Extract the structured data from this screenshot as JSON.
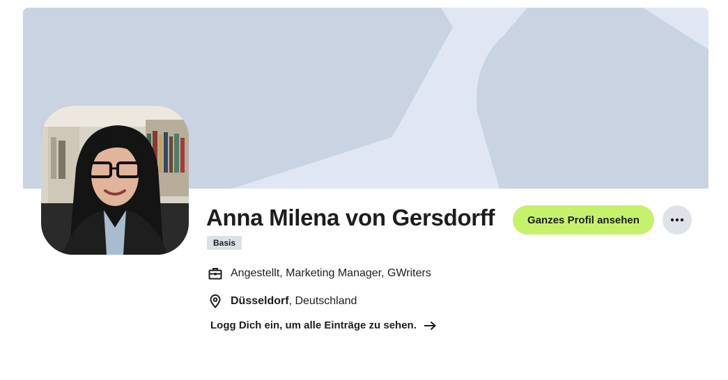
{
  "profile": {
    "name": "Anna Milena von Gersdorff",
    "membership_badge": "Basis",
    "job": "Angestellt, Marketing Manager, GWriters",
    "location_city": "Düsseldorf",
    "location_rest": ", Deutschland",
    "login_prompt": "Logg Dich ein, um alle Einträge zu sehen."
  },
  "actions": {
    "view_profile_label": "Ganzes Profil ansehen",
    "more_options_icon": "more-dots-icon"
  },
  "icons": {
    "job": "briefcase-icon",
    "location": "location-pin-icon",
    "login_arrow": "arrow-right-icon"
  },
  "colors": {
    "banner_dark": "#c9d3e2",
    "banner_light": "#e0e7f3",
    "primary_button": "#c6f16d",
    "secondary_button": "#dde3e8",
    "badge_bg": "#dbe2e6",
    "text": "#1d1d1d"
  }
}
